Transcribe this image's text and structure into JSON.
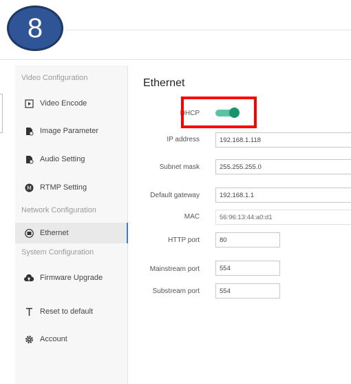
{
  "step_badge": "8",
  "sidebar": {
    "sections": {
      "video": "Video Configuration",
      "network": "Network Configuration",
      "system": "System Configuration"
    },
    "items": {
      "video_encode": "Video Encode",
      "image_parameter": "Image Parameter",
      "audio_setting": "Audio Setting",
      "rtmp_setting": "RTMP Setting",
      "ethernet": "Ethernet",
      "firmware_upgrade": "Firmware Upgrade",
      "reset": "Reset to default",
      "account": "Account"
    },
    "active": "Ethernet"
  },
  "main": {
    "title": "Ethernet",
    "dhcp_label": "DHCP",
    "dhcp_enabled": true,
    "fields": {
      "ip_label": "IP address",
      "ip_value": "192.168.1.118",
      "subnet_label": "Subnet mask",
      "subnet_value": "255.255.255.0",
      "gateway_label": "Default gateway",
      "gateway_value": "192.168.1.1",
      "mac_label": "MAC",
      "mac_value": "56:96:13:44:a0:d1",
      "http_label": "HTTP port",
      "http_value": "80",
      "mainstream_label": "Mainstream port",
      "mainstream_value": "554",
      "substream_label": "Substream port",
      "substream_value": "554"
    }
  },
  "colors": {
    "toggle": "#17946f",
    "highlight": "#ff0000",
    "badge": "#2f5597",
    "active_border": "#3a7bd5"
  }
}
